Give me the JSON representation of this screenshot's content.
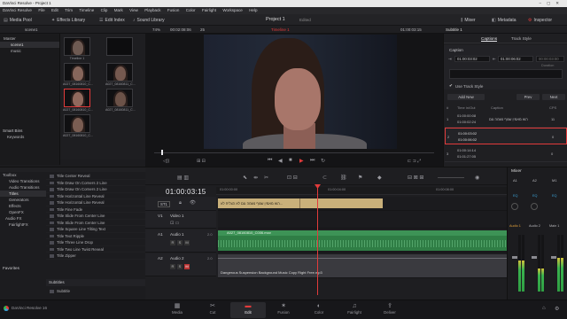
{
  "window": {
    "title": "DaVinci Resolve - Project 1"
  },
  "menu": [
    "DaVinci Resolve",
    "File",
    "Edit",
    "Trim",
    "Timeline",
    "Clip",
    "Mark",
    "View",
    "Playback",
    "Fusion",
    "Color",
    "Fairlight",
    "Workspace",
    "Help"
  ],
  "toolbar": {
    "media_pool": "Media Pool",
    "effects_library": "Effects Library",
    "edit_index": "Edit Index",
    "sound_library": "Sound Library",
    "project_title": "Project 1",
    "project_status": "Edited",
    "mixer": "Mixer",
    "metadata": "Metadata",
    "inspector": "Inspector"
  },
  "subbar": {
    "bin_name": "scene1",
    "zoom": "74%",
    "source_tc": "00:02:08:06",
    "fps": "25",
    "timeline_name": "Timeline 1",
    "record_tc": "01:00:03:15",
    "inspector_title": "Subtitle 1"
  },
  "media_pool": {
    "bins": [
      "Master",
      "scene1",
      "music"
    ],
    "clips": [
      {
        "label": "Timeline 1"
      },
      {
        "label": ""
      },
      {
        "label": "A027_08160810_C..."
      },
      {
        "label": "A027_08160811_C..."
      },
      {
        "label": "A027_08160810_C..."
      },
      {
        "label": "A027_08160811_C..."
      },
      {
        "label": "A027_08160810_C..."
      }
    ],
    "smart_bins_title": "Smart Bins",
    "smart_bins": [
      "Keywords"
    ]
  },
  "viewer": {
    "transport": [
      "⏮",
      "◀",
      "■",
      "▶",
      "⏭",
      "↻"
    ]
  },
  "inspector": {
    "tabs": [
      "Captions",
      "Track Style"
    ],
    "caption_label": "Caption",
    "in_tc": "01:00:03:02",
    "out_tc": "01:00:06:02",
    "duration_label": "Duration",
    "duration": "00:00:03:00",
    "use_track_style": "Use Track Style",
    "add_new": "Add New",
    "prev": "Prev",
    "next": "Next",
    "table_headers": [
      "#",
      "Time in/Out",
      "Caption",
      "CPS"
    ],
    "rows": [
      {
        "num": "1",
        "tin": "01:00:00:08",
        "tout": "01:00:02:24",
        "caption": "הוא מאמין שגוף נשמה וגם",
        "cps": "11"
      },
      {
        "num": "2",
        "tin": "01:00:03:02",
        "tout": "01:00:06:02",
        "caption": "",
        "cps": "0"
      },
      {
        "num": "3",
        "tin": "01:00:14:14",
        "tout": "01:01:27:05",
        "caption": "",
        "cps": "0"
      }
    ]
  },
  "effects": {
    "toolbox": [
      "Toolbox",
      "Video Transitions",
      "Audio Transitions",
      "Titles",
      "Generators",
      "Effects",
      "OpenFX",
      "Audio FX",
      "FairlightFX"
    ],
    "favorites": "Favorites",
    "titles": [
      "Title Center Reveal",
      "Title Draw On Corners 2 Line",
      "Title Draw On Corners 2 Line",
      "Title Horizontal Line Reveal",
      "Title Horizontal Line Reveal",
      "Title Fine Fade",
      "Title Slide From Center Line",
      "Title Slide From Center Line",
      "Title Square Line Tilting Text",
      "Title Text Ripple",
      "Title Three Line Drop",
      "Title Two Line Twist Reveal",
      "Title Zipper"
    ],
    "subtitles_header": "Subtitles",
    "subtitle_item": "Subtitle"
  },
  "timeline": {
    "timecode": "01:00:03:15",
    "ruler": [
      "01:00:00:00",
      "01:00:04:00",
      "01:00:08:00"
    ],
    "tracks": {
      "st1": {
        "id": "ST1",
        "clip": "הוא מאמין שגוף נשמה וגם לא הצליח לא..."
      },
      "v1": {
        "id": "V1",
        "name": "Video 1"
      },
      "a1": {
        "id": "A1",
        "name": "Audio 1",
        "ch": "2.0",
        "clip": "A027_08160810_C006.mov"
      },
      "a2": {
        "id": "A2",
        "name": "Audio 2",
        "ch": "2.0",
        "clip": "Dangerous Suspension Background Music Copy Right Free.mp3"
      }
    }
  },
  "mixer": {
    "title": "Mixer",
    "channels": [
      "A1",
      "A2",
      "M1"
    ],
    "eq": "EQ",
    "strip_names": [
      "Audio 1",
      "Audio 2",
      "Main 1"
    ],
    "levels": [
      0.55,
      0.4,
      0.6
    ]
  },
  "pages": [
    "Media",
    "Cut",
    "Edit",
    "Fusion",
    "Color",
    "Fairlight",
    "Deliver"
  ],
  "active_page": "Edit",
  "footer": {
    "app": "DaVinci Resolve 16"
  },
  "colors": {
    "accent": "#e23b3b",
    "audio_green": "#2f7d45",
    "subtitle_clip": "#c9b07a"
  }
}
